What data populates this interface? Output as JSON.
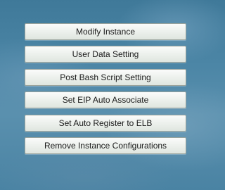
{
  "menu": {
    "items": [
      {
        "label": "Modify Instance"
      },
      {
        "label": "User Data Setting"
      },
      {
        "label": "Post Bash Script Setting"
      },
      {
        "label": "Set EIP Auto Associate"
      },
      {
        "label": "Set Auto Register to ELB"
      },
      {
        "label": "Remove Instance Configurations"
      }
    ]
  }
}
